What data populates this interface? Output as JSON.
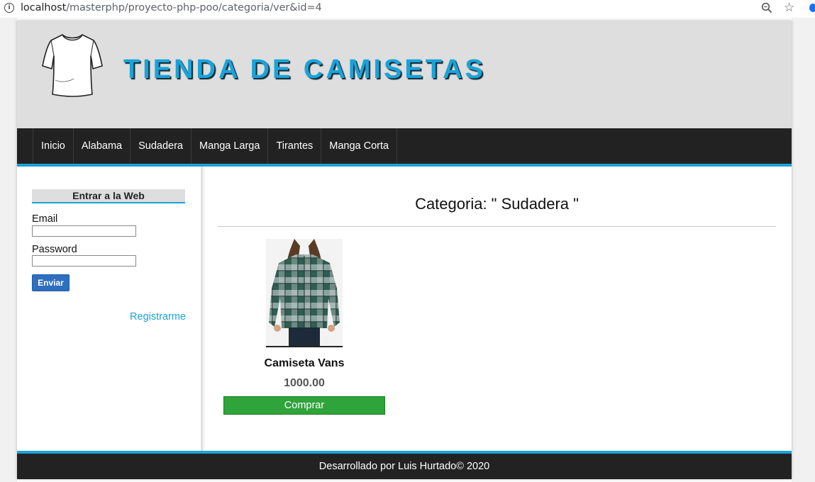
{
  "browser": {
    "url_host": "localhost",
    "url_path": "/masterphp/proyecto-php-poo/categoria/ver&id=4"
  },
  "header": {
    "title": "TIENDA DE CAMISETAS",
    "logo_icon": "tshirt-icon"
  },
  "nav": {
    "items": [
      "Inicio",
      "Alabama",
      "Sudadera",
      "Manga Larga",
      "Tirantes",
      "Manga Corta"
    ]
  },
  "sidebar": {
    "login_title": "Entrar a la Web",
    "email_label": "Email",
    "password_label": "Password",
    "submit_label": "Enviar",
    "register_link": "Registrarme"
  },
  "main": {
    "category_title": "Categoria: \" Sudadera \"",
    "products": [
      {
        "name": "Camiseta Vans",
        "price": "1000.00",
        "buy_label": "Comprar"
      }
    ]
  },
  "footer": {
    "text": "Desarrollado por Luis Hurtado© 2020"
  },
  "colors": {
    "accent": "#1aa3d9",
    "nav_bg": "#222222",
    "header_bg": "#dedede",
    "buy_button": "#2ea43a",
    "submit_button": "#2f6fbf"
  }
}
